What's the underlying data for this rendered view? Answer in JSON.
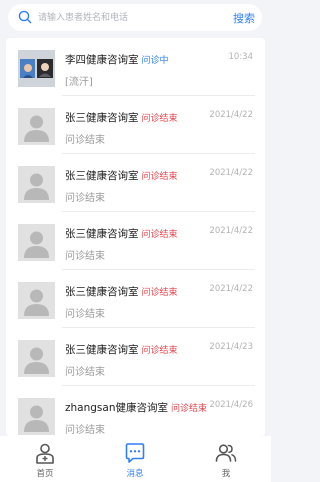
{
  "search": {
    "placeholder": "请输入患者姓名和电话",
    "button_label": "搜索",
    "icon": "search-icon"
  },
  "conversations": [
    {
      "avatar": "photo",
      "title": "李四健康咨询室",
      "status": "问诊中",
      "status_type": "active",
      "time": "10:34",
      "preview": "[流汗]"
    },
    {
      "avatar": "default-user",
      "title": "张三健康咨询室",
      "status": "问诊结束",
      "status_type": "ended",
      "time": "2021/4/22",
      "preview": "问诊结束"
    },
    {
      "avatar": "default-user",
      "title": "张三健康咨询室",
      "status": "问诊结束",
      "status_type": "ended",
      "time": "2021/4/22",
      "preview": "问诊结束"
    },
    {
      "avatar": "default-user",
      "title": "张三健康咨询室",
      "status": "问诊结束",
      "status_type": "ended",
      "time": "2021/4/22",
      "preview": "问诊结束"
    },
    {
      "avatar": "default-user",
      "title": "张三健康咨询室",
      "status": "问诊结束",
      "status_type": "ended",
      "time": "2021/4/22",
      "preview": "问诊结束"
    },
    {
      "avatar": "default-user",
      "title": "张三健康咨询室",
      "status": "问诊结束",
      "status_type": "ended",
      "time": "2021/4/23",
      "preview": "问诊结束"
    },
    {
      "avatar": "default-user",
      "title": "zhangsan健康咨询室",
      "status": "问诊结束",
      "status_type": "ended",
      "time": "2021/4/26",
      "preview": "问诊结束"
    }
  ],
  "tabbar": {
    "items": [
      {
        "label": "首页",
        "icon": "doctor-icon",
        "active": false
      },
      {
        "label": "消息",
        "icon": "message-icon",
        "active": true
      },
      {
        "label": "我",
        "icon": "profile-icon",
        "active": false
      }
    ]
  },
  "colors": {
    "accent": "#2f7ff5",
    "status_ended": "#e8454c",
    "background": "#f2f4f7"
  }
}
